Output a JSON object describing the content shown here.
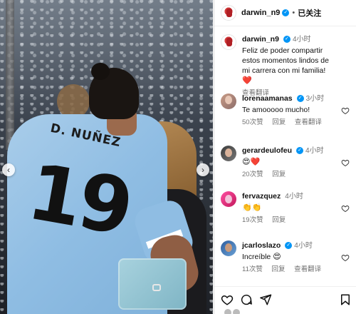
{
  "header": {
    "username": "darwin_n9",
    "verified_symbol": "✓",
    "separator": "•",
    "follow_status": "已关注"
  },
  "photo": {
    "jersey_name": "D. NUÑEZ",
    "jersey_number": "19",
    "prev_symbol": "‹",
    "next_symbol": "›"
  },
  "caption": {
    "username": "darwin_n9",
    "time": "4小时",
    "text": "Feliz de poder compartir estos momentos lindos de mi carrera con mi familia!",
    "emoji": "❤️",
    "translate": "查看翻译"
  },
  "comments": [
    {
      "username": "lorenaamanas",
      "time": "3小时",
      "text": "Te amooooo mucho!",
      "emoji": "",
      "likes": "50次赞",
      "reply": "回复",
      "translate": "查看翻译"
    },
    {
      "username": "gerardeulofeu",
      "time": "4小时",
      "text": "",
      "emoji": "😍❤️",
      "likes": "20次赞",
      "reply": "回复",
      "translate": ""
    },
    {
      "username": "fervazquez",
      "time": "4小时",
      "text": "",
      "emoji": "👏👏",
      "likes": "19次赞",
      "reply": "回复",
      "translate": ""
    },
    {
      "username": "jcarloslazo",
      "time": "4小时",
      "text": "Increíble ",
      "emoji": "😍",
      "likes": "11次赞",
      "reply": "回复",
      "translate": "查看翻译"
    }
  ],
  "icons": {
    "like": "heart-icon",
    "comment": "comment-icon",
    "share": "share-icon",
    "save": "bookmark-icon"
  },
  "colors": {
    "verified": "#0095f6",
    "heart_red": "#e0245e",
    "muted": "#737373",
    "jersey": "#8fbde3"
  }
}
